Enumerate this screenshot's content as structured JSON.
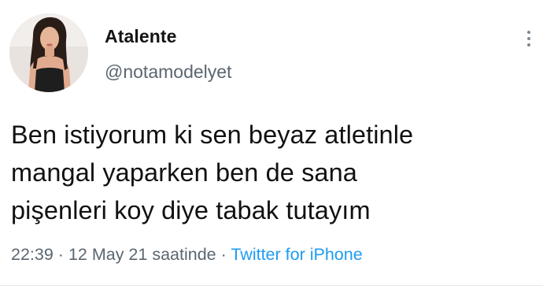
{
  "user": {
    "display_name": "Atalente",
    "username": "@notamodelyet",
    "avatar_icon": "profile-photo-avatar"
  },
  "tweet": {
    "lines": [
      "Ben istiyorum ki sen beyaz atletinle",
      "mangal yaparken ben de sana",
      "pişenleri koy diye tabak tutayım"
    ]
  },
  "meta": {
    "time": "22:39",
    "separator": "·",
    "date_suffix": "12 May 21 saatinde",
    "source": "Twitter for iPhone"
  },
  "icons": {
    "more": "more-vertical-icon"
  },
  "colors": {
    "text": "#111111",
    "secondary": "#5b6670",
    "link": "#1d9bf0",
    "background": "#ffffff"
  }
}
